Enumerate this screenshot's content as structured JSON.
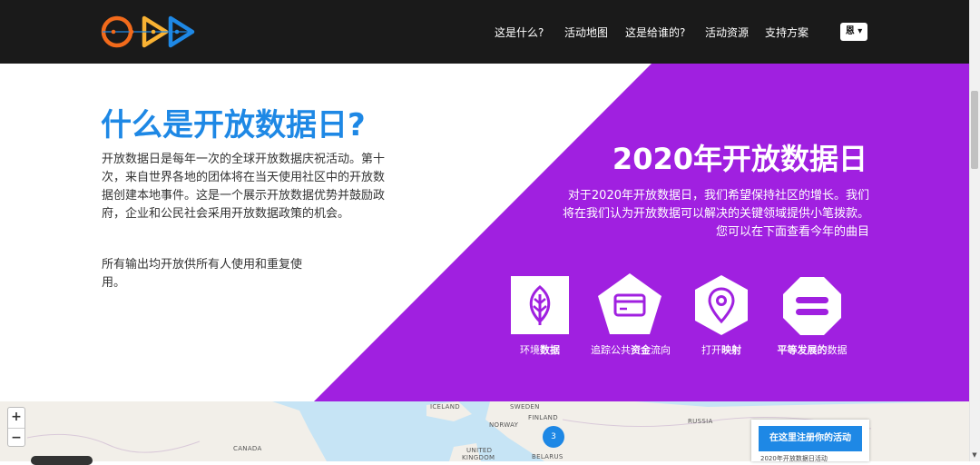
{
  "header": {
    "nav": [
      {
        "label": "这是什么?"
      },
      {
        "label": "活动地图"
      },
      {
        "label": "这是给谁的?"
      },
      {
        "label": "活动资源"
      },
      {
        "label": "支持方案"
      }
    ],
    "language": "恩 ▾"
  },
  "intro": {
    "title": "什么是开放数据日?",
    "paragraph1": "开放数据日是每年一次的全球开放数据庆祝活动。第十次，来自世界各地的团体将在当天使用社区中的开放数据创建本地事件。这是一个展示开放数据优势并鼓励政府，企业和公民社会采用开放数据政策的机会。",
    "paragraph2": "所有输出均开放供所有人使用和重复使用。"
  },
  "hero": {
    "title": "2020年开放数据日",
    "description": "对于2020年开放数据日，我们希望保持社区的增长。我们将在我们认为开放数据可以解决的关键领域提供小笔拨款。您可以在下面查看今年的曲目",
    "features": [
      {
        "pre": "环境",
        "bold": "数据",
        "post": ""
      },
      {
        "pre": "追踪公共",
        "bold": "资金",
        "post": "流向"
      },
      {
        "pre": "打开",
        "bold": "映射",
        "post": ""
      },
      {
        "pre": "",
        "bold": "平等发展的",
        "post": "数据"
      }
    ]
  },
  "map": {
    "zoom_in": "+",
    "zoom_out": "−",
    "labels": {
      "iceland": "ICELAND",
      "sweden": "SWEDEN",
      "finland": "FINLAND",
      "norway": "NORWAY",
      "russia": "RUSSIA",
      "canada": "CANADA",
      "united": "UNITED",
      "kingdom": "KINGDOM",
      "belarus": "BELARUS"
    },
    "cluster_count": "3",
    "register_button": "在这里注册你的活动",
    "register_sub": "2020年开放数据日活动"
  },
  "colors": {
    "header_bg": "#1a1a1a",
    "accent_blue": "#1e88e5",
    "hero_purple": "#a020e0",
    "map_sea": "#c6e4f5",
    "map_land": "#f2efe9"
  }
}
